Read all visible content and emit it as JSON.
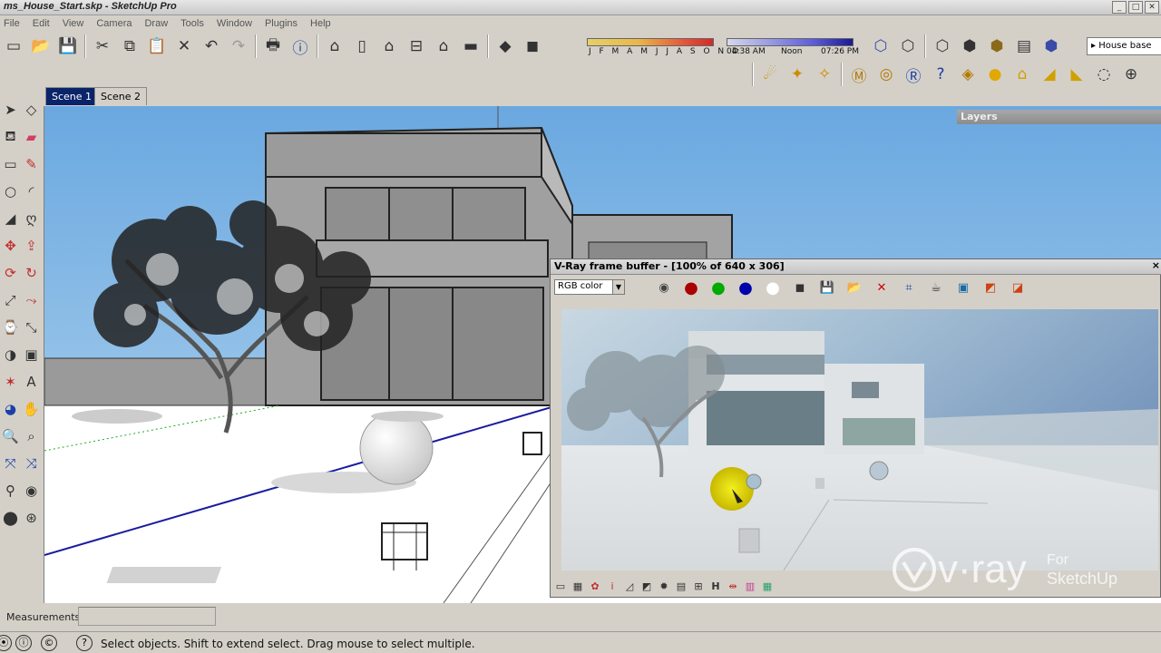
{
  "window": {
    "title": "ms_House_Start.skp - SketchUp Pro"
  },
  "menu": [
    "File",
    "Edit",
    "View",
    "Camera",
    "Draw",
    "Tools",
    "Window",
    "Plugins",
    "Help"
  ],
  "shadow": {
    "months": "J F M A M J J A S O N D",
    "time1": "04:38 AM",
    "noon": "Noon",
    "time2": "07:26 PM"
  },
  "layer_dropdown": "House base",
  "scenes": [
    "Scene 1",
    "Scene 2"
  ],
  "layers_panel": "Layers",
  "vfb": {
    "title": "V-Ray frame buffer - [100% of 640 x 306]",
    "channel": "RGB color",
    "bottom_h": "H"
  },
  "watermark": {
    "brand": "v·ray",
    "for": "For",
    "product": "SketchUp"
  },
  "status": {
    "measurements_label": "Measurements",
    "text": "Select objects. Shift to extend select. Drag mouse to select multiple."
  },
  "icons": [
    "new-icon",
    "open-icon",
    "save-icon",
    "cut-icon",
    "copy-icon",
    "paste-icon",
    "erase-icon",
    "undo-icon",
    "redo-icon",
    "print-icon",
    "info-icon"
  ]
}
